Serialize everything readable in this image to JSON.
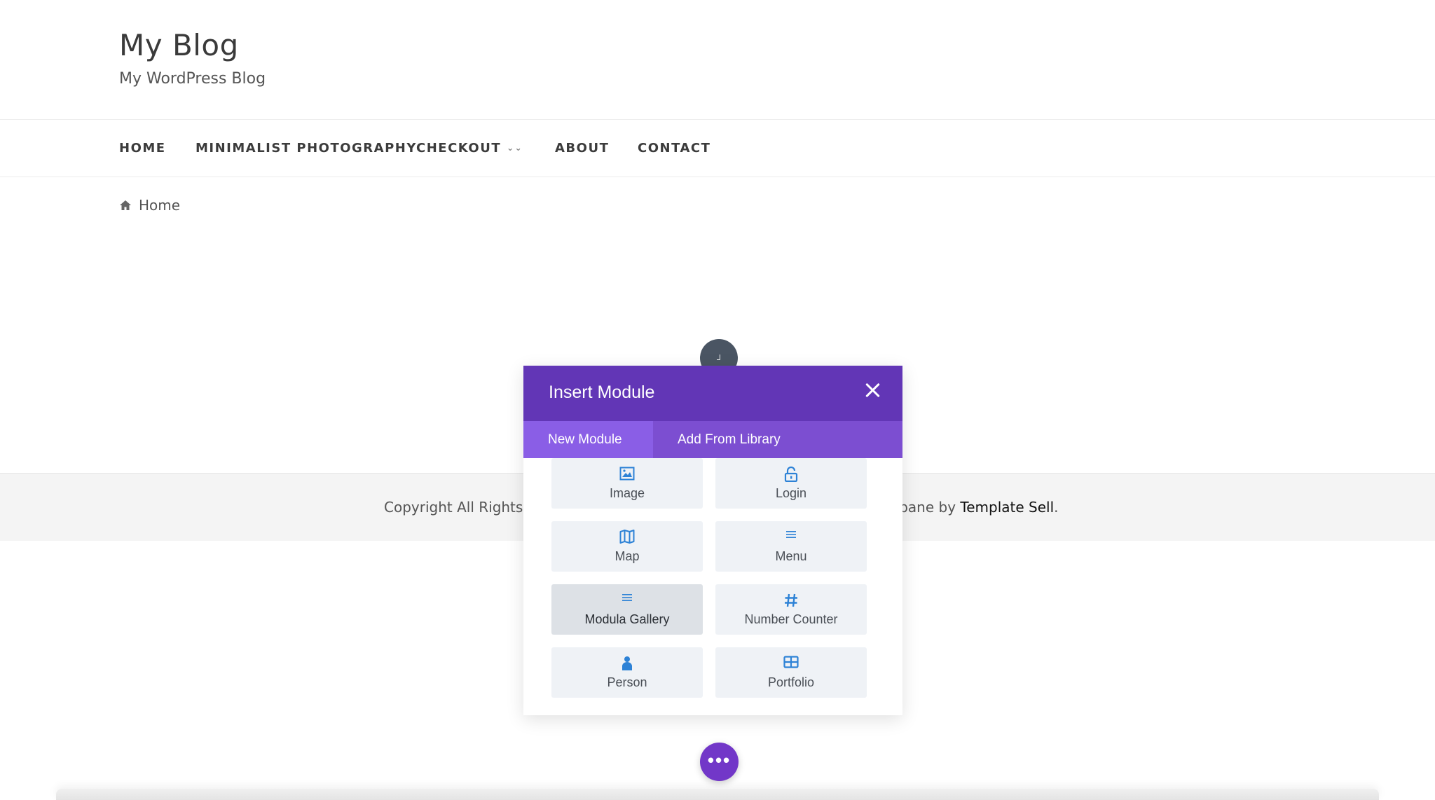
{
  "site": {
    "title": "My Blog",
    "tagline": "My WordPress Blog"
  },
  "nav": {
    "items": [
      {
        "label": "HOME"
      },
      {
        "label": "MINIMALIST PHOTOGRAPHY"
      },
      {
        "label": "CHECKOUT",
        "has_dropdown": true
      },
      {
        "label": "ABOUT"
      },
      {
        "label": "CONTACT"
      }
    ]
  },
  "breadcrumb": {
    "icon": "home-icon",
    "label": "Home"
  },
  "footer": {
    "left_text": "Copyright All Rights R",
    "right_text": "rbane by ",
    "link_text": "Template Sell",
    "trailing": "."
  },
  "modal": {
    "title": "Insert Module",
    "tabs": [
      {
        "label": "New Module",
        "active": true
      },
      {
        "label": "Add From Library",
        "active": false
      }
    ],
    "modules": [
      {
        "label": "Image",
        "icon": "image-icon"
      },
      {
        "label": "Login",
        "icon": "lock-icon"
      },
      {
        "label": "Map",
        "icon": "map-icon"
      },
      {
        "label": "Menu",
        "icon": "menu-icon"
      },
      {
        "label": "Modula Gallery",
        "icon": "menu-icon",
        "hovered": true
      },
      {
        "label": "Number Counter",
        "icon": "hash-icon"
      },
      {
        "label": "Person",
        "icon": "person-icon"
      },
      {
        "label": "Portfolio",
        "icon": "grid-icon"
      }
    ]
  },
  "colors": {
    "modal_header": "#6236b6",
    "modal_tabs": "#7c4ed1",
    "active_tab": "#8a5ee6",
    "icon_blue": "#2d82d6",
    "fab_purple": "#7237c8"
  }
}
